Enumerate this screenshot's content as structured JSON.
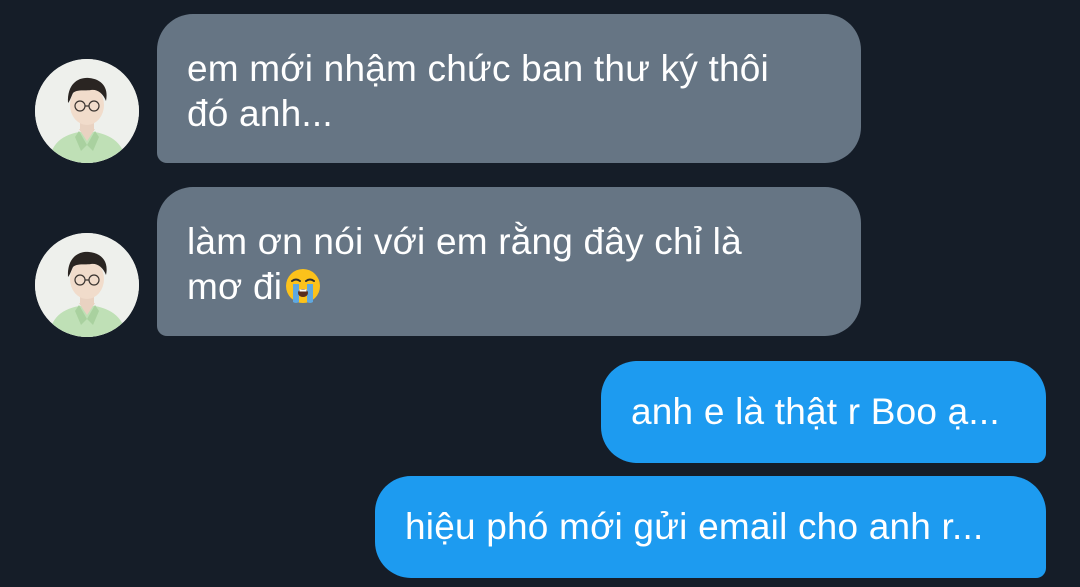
{
  "conversation": {
    "messages": [
      {
        "direction": "incoming",
        "lines": [
          "em mới nhậm chức ban thư ký thôi",
          "đó anh..."
        ]
      },
      {
        "direction": "incoming",
        "lines": [
          "làm ơn nói với em rằng đây chỉ là",
          "mơ đi"
        ],
        "emoji": "loudly-crying-face-icon"
      },
      {
        "direction": "outgoing",
        "lines": [
          "anh e là thật r Boo ạ..."
        ]
      },
      {
        "direction": "outgoing",
        "lines": [
          "hiệu phó mới gửi email cho anh r..."
        ]
      }
    ]
  },
  "colors": {
    "background": "#151d28",
    "incoming_bubble": "#667584",
    "outgoing_bubble": "#1d9bf0",
    "text": "#ffffff",
    "avatar_shirt": "#bfe0b6"
  }
}
